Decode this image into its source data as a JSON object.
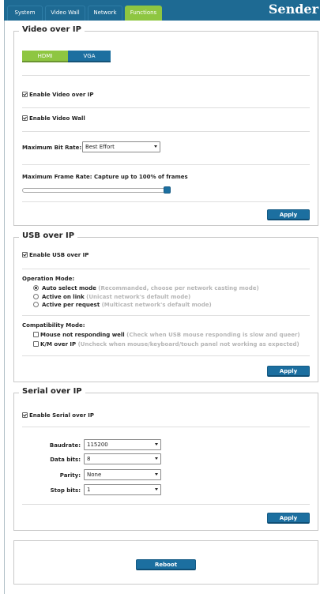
{
  "header": {
    "tabs": [
      {
        "label": "System"
      },
      {
        "label": "Video Wall"
      },
      {
        "label": "Network"
      },
      {
        "label": "Functions",
        "active": true
      }
    ],
    "brand": "Sender"
  },
  "video": {
    "legend": "Video over IP",
    "source_buttons": {
      "hdmi": "HDMI",
      "vga": "VGA",
      "selected": "HDMI"
    },
    "enable_video_label": "Enable Video over IP",
    "enable_video_checked": true,
    "enable_wall_label": "Enable Video Wall",
    "enable_wall_checked": true,
    "bitrate_label": "Maximum Bit Rate:",
    "bitrate_value": "Best Effort",
    "framerate_label": "Maximum Frame Rate: Capture up to 100% of frames",
    "framerate_percent": 100,
    "apply_label": "Apply"
  },
  "usb": {
    "legend": "USB over IP",
    "enable_label": "Enable USB over IP",
    "enable_checked": true,
    "operation_title": "Operation Mode:",
    "modes": [
      {
        "label": "Auto select mode",
        "note": "(Recommanded, choose per network casting mode)",
        "selected": true
      },
      {
        "label": "Active on link",
        "note": "(Unicast network's default mode)",
        "selected": false
      },
      {
        "label": "Active per request",
        "note": "(Multicast network's default mode)",
        "selected": false
      }
    ],
    "compat_title": "Compatibility Mode:",
    "compat": [
      {
        "label": "Mouse not responding well",
        "note": "(Check when USB mouse responding is slow and queer)",
        "checked": false
      },
      {
        "label": "K/M over IP",
        "note": "(Uncheck when mouse/keyboard/touch panel not working as expected)",
        "checked": false
      }
    ],
    "apply_label": "Apply"
  },
  "serial": {
    "legend": "Serial over IP",
    "enable_label": "Enable Serial over IP",
    "enable_checked": true,
    "fields": [
      {
        "label": "Baudrate:",
        "value": "115200"
      },
      {
        "label": "Data bits:",
        "value": "8"
      },
      {
        "label": "Parity:",
        "value": "None"
      },
      {
        "label": "Stop bits:",
        "value": "1"
      }
    ],
    "apply_label": "Apply"
  },
  "reboot_label": "Reboot",
  "colors": {
    "header": "#1e6a93",
    "active_tab": "#8ec641",
    "button": "#1c6fa0"
  }
}
